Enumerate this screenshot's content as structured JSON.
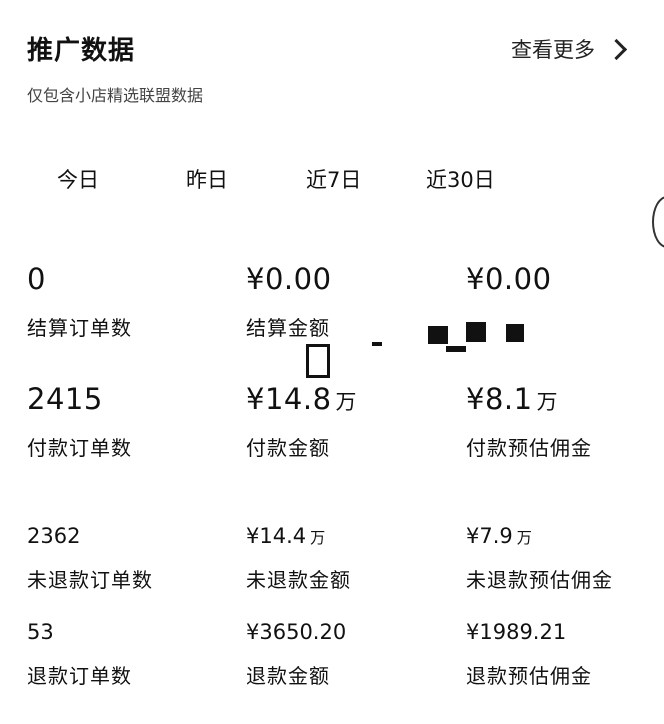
{
  "header": {
    "title": "推广数据",
    "more_label": "查看更多",
    "subtitle": "仅包含小店精选联盟数据"
  },
  "tabs": [
    {
      "label": "今日"
    },
    {
      "label": "昨日"
    },
    {
      "label": "近7日"
    },
    {
      "label": "近30日"
    }
  ],
  "metrics": {
    "settled_orders": {
      "value": "0",
      "label": "结算订单数"
    },
    "settled_amount": {
      "value": "¥0.00",
      "label": "结算金额"
    },
    "settled_commission": {
      "value": "¥0.00",
      "label": ""
    },
    "paid_orders": {
      "value": "2415",
      "label": "付款订单数"
    },
    "paid_amount": {
      "value": "¥14.8",
      "unit": "万",
      "label": "付款金额"
    },
    "paid_est_commission": {
      "value": "¥8.1",
      "unit": "万",
      "label": "付款预估佣金"
    },
    "unrefunded_orders": {
      "value": "2362",
      "label": "未退款订单数"
    },
    "unrefunded_amount": {
      "value": "¥14.4",
      "unit": "万",
      "label": "未退款金额"
    },
    "unrefunded_est_commission": {
      "value": "¥7.9",
      "unit": "万",
      "label": "未退款预估佣金"
    },
    "refund_orders": {
      "value": "53",
      "label": "退款订单数"
    },
    "refund_amount": {
      "value": "¥3650.20",
      "label": "退款金额"
    },
    "refund_est_commission": {
      "value": "¥1989.21",
      "label": "退款预估佣金"
    }
  }
}
